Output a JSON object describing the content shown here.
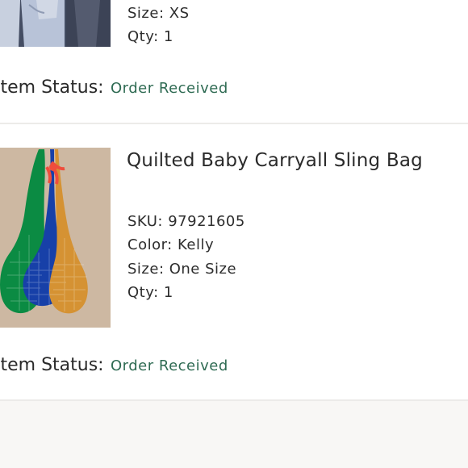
{
  "orders": {
    "items": [
      {
        "image_icon": "jeans-image-icon",
        "size_line": "Size: XS",
        "qty_line": "Qty: 1",
        "status_label": "Item Status:",
        "status_value": "Order Received"
      },
      {
        "image_icon": "quilted-sling-bags-image-icon",
        "title": "Quilted Baby Carryall Sling Bag",
        "sku_line": "SKU: 97921605",
        "color_line": "Color: Kelly",
        "size_line": "Size: One Size",
        "qty_line": "Qty: 1",
        "status_label": "Item Status:",
        "status_value": "Order Received"
      }
    ]
  },
  "colors": {
    "status_green": "#2f6b53",
    "divider": "#ecebe9",
    "page_bg": "#ffffff",
    "footer_bg": "#f8f7f5"
  }
}
